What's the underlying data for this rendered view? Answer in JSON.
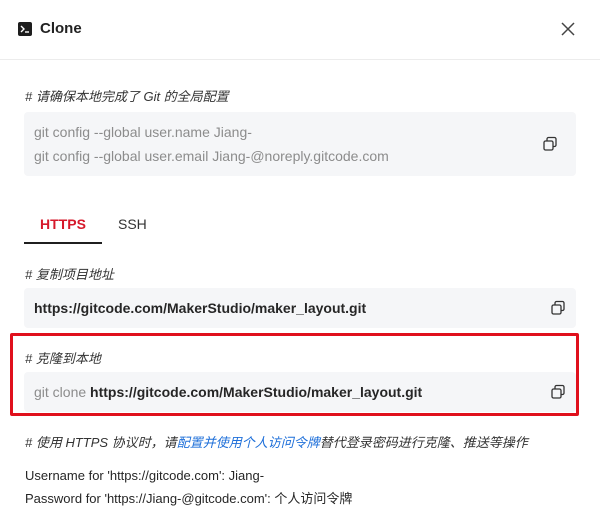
{
  "dialog": {
    "title": "Clone",
    "icons": {
      "app": "terminal-icon",
      "close": "close-icon",
      "copy": "copy-icon"
    }
  },
  "config_section": {
    "comment": "# 请确保本地完成了 Git 的全局配置",
    "lines": [
      "git config --global user.name Jiang-",
      "git config --global user.email Jiang-@noreply.gitcode.com"
    ]
  },
  "tabs": [
    {
      "label": "HTTPS",
      "active": true
    },
    {
      "label": "SSH",
      "active": false
    }
  ],
  "copy_url_section": {
    "comment": "# 复制项目地址",
    "url": "https://gitcode.com/MakerStudio/maker_layout.git"
  },
  "clone_section": {
    "comment": "# 克隆到本地",
    "prefix": "git clone",
    "url": "https://gitcode.com/MakerStudio/maker_layout.git"
  },
  "https_note": {
    "prefix": "# 使用 HTTPS 协议时，请",
    "link": "配置并使用个人访问令牌",
    "suffix": "替代登录密码进行克隆、推送等操作"
  },
  "credentials": [
    "Username for 'https://gitcode.com': Jiang-",
    "Password for 'https://Jiang-@gitcode.com': 个人访问令牌"
  ],
  "colors": {
    "accent": "#d6192b",
    "highlight": "#e0101c",
    "link": "#1e6fd9",
    "code_bg": "#f5f6f8"
  }
}
